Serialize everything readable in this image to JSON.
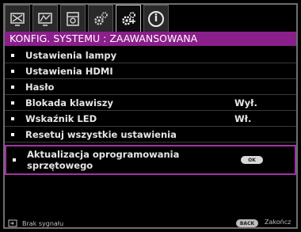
{
  "tabs": [
    {
      "icon": "picture-icon"
    },
    {
      "icon": "picture-advanced-icon"
    },
    {
      "icon": "audio-video-icon"
    },
    {
      "icon": "system-basic-icon"
    },
    {
      "icon": "system-advanced-icon",
      "active": true
    },
    {
      "icon": "info-icon",
      "glyph": "i"
    }
  ],
  "title": "KONFIG. SYSTEMU : ZAAWANSOWANA",
  "menu": [
    {
      "label": "Ustawienia lampy",
      "value": ""
    },
    {
      "label": "Ustawienia HDMI",
      "value": ""
    },
    {
      "label": "Hasło",
      "value": ""
    },
    {
      "label": "Blokada klawiszy",
      "value": "Wył."
    },
    {
      "label": "Wskaźnik LED",
      "value": "Wł."
    },
    {
      "label": "Resetuj wszystkie ustawienia",
      "value": ""
    }
  ],
  "selected_item": {
    "label_line1": "Aktualizacja oprogramowania",
    "label_line2": "sprzętowego",
    "button": "OK"
  },
  "footer": {
    "source_status": "Brak sygnału",
    "back_button": "BACK",
    "exit_label": "Zakończ"
  },
  "colors": {
    "accent": "#8b1f8b",
    "selected_border": "#a531a5",
    "background": "#000000"
  }
}
